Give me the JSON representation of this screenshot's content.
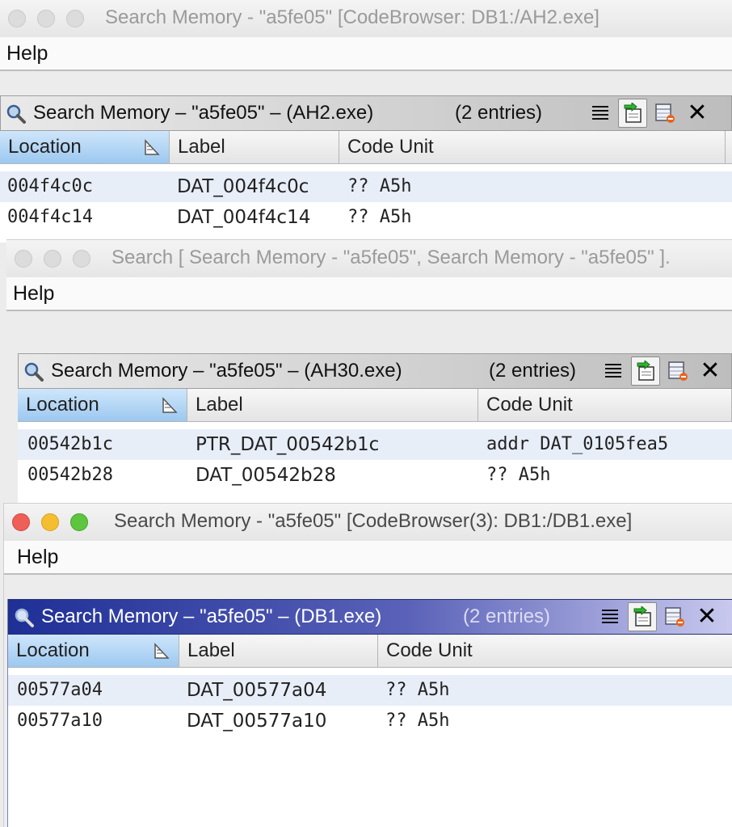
{
  "windows": [
    {
      "title": "Search Memory - \"a5fe05\" [CodeBrowser: DB1:/AH2.exe]",
      "menu": "Help",
      "panel_title": "Search Memory – \"a5fe05\" – (AH2.exe)",
      "entries": "(2 entries)",
      "columns": [
        "Location",
        "Label",
        "Code Unit"
      ],
      "rows": [
        {
          "location": "004f4c0c",
          "label": "DAT_004f4c0c",
          "code_unit": "?? A5h"
        },
        {
          "location": "004f4c14",
          "label": "DAT_004f4c14",
          "code_unit": "?? A5h"
        }
      ]
    },
    {
      "title": "Search [ Search Memory - \"a5fe05\", Search Memory - \"a5fe05\" ].",
      "menu": "Help",
      "panel_title": "Search Memory – \"a5fe05\" – (AH30.exe)",
      "entries": "(2 entries)",
      "columns": [
        "Location",
        "Label",
        "Code Unit"
      ],
      "rows": [
        {
          "location": "00542b1c",
          "label": "PTR_DAT_00542b1c",
          "code_unit": "addr DAT_0105fea5"
        },
        {
          "location": "00542b28",
          "label": "DAT_00542b28",
          "code_unit": "?? A5h"
        }
      ]
    },
    {
      "title": "Search Memory - \"a5fe05\" [CodeBrowser(3): DB1:/DB1.exe]",
      "menu": "Help",
      "panel_title": "Search Memory – \"a5fe05\" – (DB1.exe)",
      "entries": "(2 entries)",
      "columns": [
        "Location",
        "Label",
        "Code Unit"
      ],
      "rows": [
        {
          "location": "00577a04",
          "label": "DAT_00577a04",
          "code_unit": "?? A5h"
        },
        {
          "location": "00577a10",
          "label": "DAT_00577a10",
          "code_unit": "?? A5h"
        }
      ]
    }
  ],
  "icons": {
    "panel": "magnifier-icon",
    "tools": [
      "list-lines-icon",
      "go-to-selection-icon",
      "table-delete-icon",
      "close-icon"
    ],
    "sort": "sort-ascending-icon"
  },
  "colors": {
    "active_header": "#1e2f96",
    "sorted_column": "#9cc8f0",
    "alt_row": "#e8eef8"
  }
}
